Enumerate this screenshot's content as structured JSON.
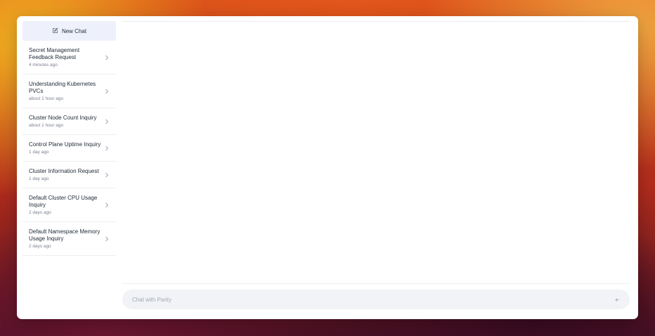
{
  "sidebar": {
    "new_chat_label": "New Chat",
    "chats": [
      {
        "title": "Secret Management Feedback Request",
        "time": "4 minutes ago"
      },
      {
        "title": "Understanding Kubernetes PVCs",
        "time": "about 1 hour ago"
      },
      {
        "title": "Cluster Node Count Inquiry",
        "time": "about 1 hour ago"
      },
      {
        "title": "Control Plane Uptime Inquiry",
        "time": "1 day ago"
      },
      {
        "title": "Cluster Information Request",
        "time": "1 day ago"
      },
      {
        "title": "Default Cluster CPU Usage Inquiry",
        "time": "2 days ago"
      },
      {
        "title": "Default Namespace Memory Usage Inquiry",
        "time": "2 days ago"
      }
    ]
  },
  "composer": {
    "placeholder": "Chat with Parity",
    "value": ""
  },
  "icons": {
    "new_chat": "pencil-square-icon",
    "chat_item": "chevron-right-icon",
    "send": "arrow-left-icon"
  }
}
